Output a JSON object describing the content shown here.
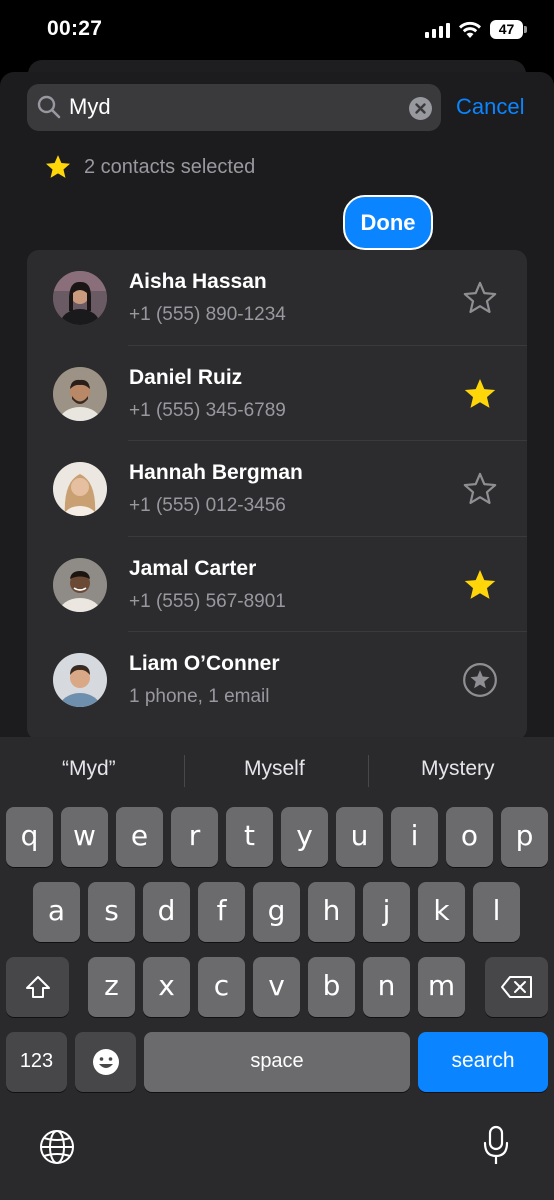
{
  "status": {
    "time": "00:27",
    "battery": "47"
  },
  "search": {
    "value": "Myd",
    "cancel_label": "Cancel"
  },
  "selection": {
    "summary": "2 contacts selected"
  },
  "done_label": "Done",
  "contacts": [
    {
      "name": "Aisha Hassan",
      "detail": "+1 (555) 890-1234",
      "favorite": false,
      "icon": "star-outline-icon"
    },
    {
      "name": "Daniel Ruiz",
      "detail": "+1 (555) 345-6789",
      "favorite": true,
      "icon": "star-filled-icon"
    },
    {
      "name": "Hannah Bergman",
      "detail": "+1 (555) 012-3456",
      "favorite": false,
      "icon": "star-outline-icon"
    },
    {
      "name": "Jamal Carter",
      "detail": "+1 (555) 567-8901",
      "favorite": true,
      "icon": "star-filled-icon"
    },
    {
      "name": "Liam O’Conner",
      "detail": "1 phone, 1 email",
      "favorite": false,
      "icon": "star-circle-icon"
    }
  ],
  "keyboard": {
    "suggestions": [
      "“Myd”",
      "Myself",
      "Mystery"
    ],
    "row1": [
      "q",
      "w",
      "e",
      "r",
      "t",
      "y",
      "u",
      "i",
      "o",
      "p"
    ],
    "row2": [
      "a",
      "s",
      "d",
      "f",
      "g",
      "h",
      "j",
      "k",
      "l"
    ],
    "row3": [
      "z",
      "x",
      "c",
      "v",
      "b",
      "n",
      "m"
    ],
    "numbers_label": "123",
    "space_label": "space",
    "search_label": "search"
  },
  "colors": {
    "accent": "#0a84ff",
    "favorite": "#ffd60a",
    "background": "#1c1c1e"
  }
}
